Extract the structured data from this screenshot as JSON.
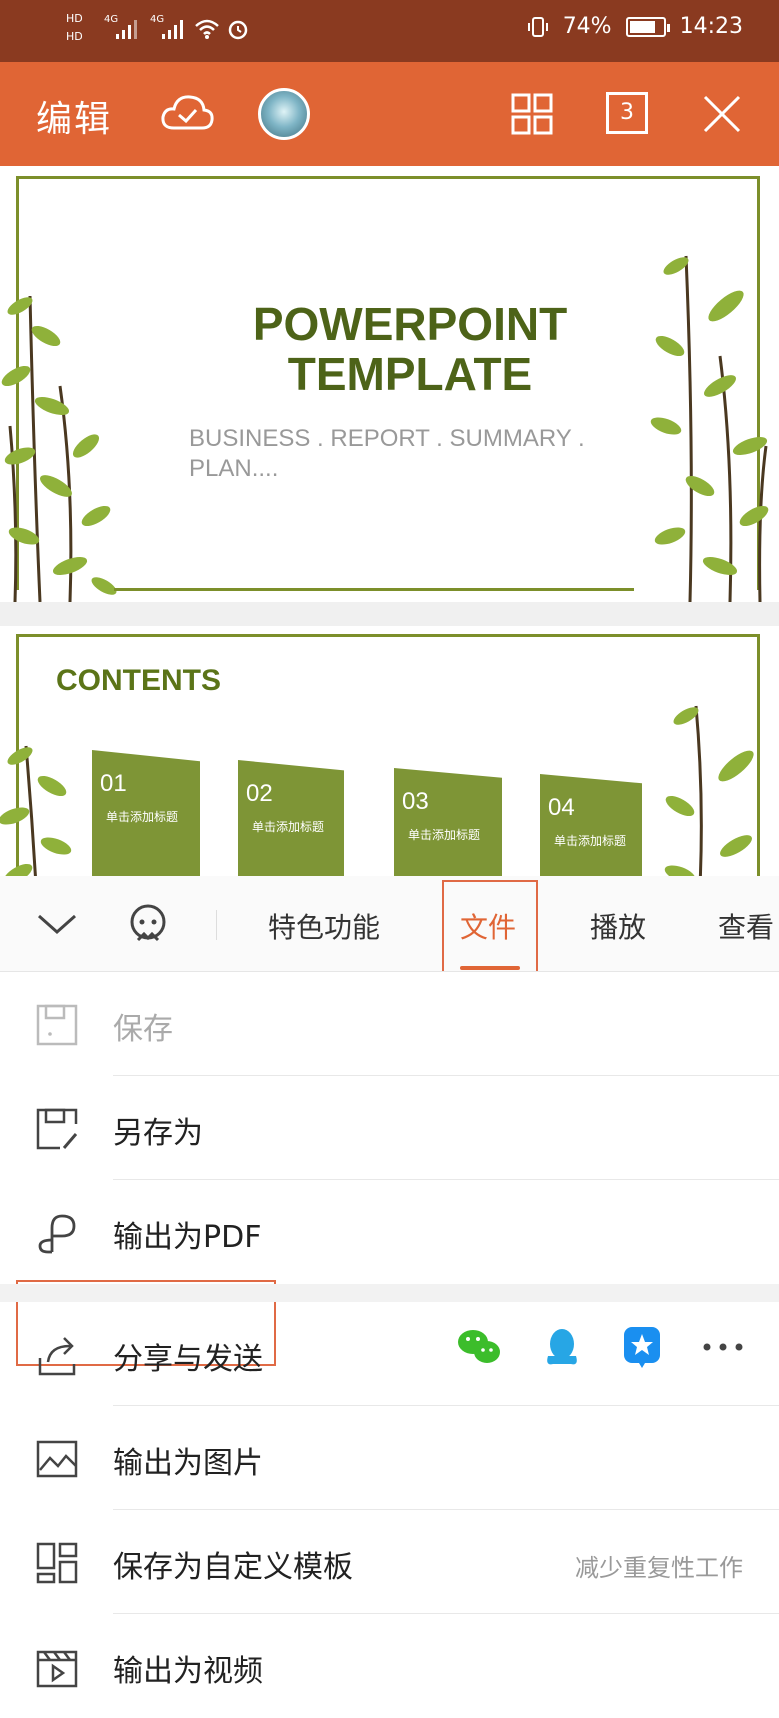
{
  "status_bar": {
    "hd1": "HD",
    "hd2": "HD",
    "net1": "4G",
    "net2": "4G",
    "battery": "74%",
    "time": "14:23"
  },
  "app_bar": {
    "title": "编辑",
    "page_count": "3"
  },
  "slide1": {
    "title_line1": "POWERPOINT",
    "title_line2": "TEMPLATE",
    "subtitle_line1": "BUSINESS . REPORT . SUMMARY .",
    "subtitle_line2": "PLAN...."
  },
  "slide2": {
    "title": "CONTENTS",
    "cards": [
      {
        "num": "01",
        "label": "单击添加标题"
      },
      {
        "num": "02",
        "label": "单击添加标题"
      },
      {
        "num": "03",
        "label": "单击添加标题"
      },
      {
        "num": "04",
        "label": "单击添加标题"
      }
    ]
  },
  "tabs": {
    "items": [
      "特色功能",
      "文件",
      "播放",
      "查看"
    ],
    "active": "文件"
  },
  "menu": {
    "save": "保存",
    "save_as": "另存为",
    "export_pdf": "输出为PDF",
    "share": "分享与发送",
    "export_image": "输出为图片",
    "save_template": "保存为自定义模板",
    "save_template_hint": "减少重复性工作",
    "export_video": "输出为视频"
  },
  "colors": {
    "accent": "#e06535",
    "status_bar": "#8a3a20",
    "slide_green": "#7c8f2a"
  }
}
